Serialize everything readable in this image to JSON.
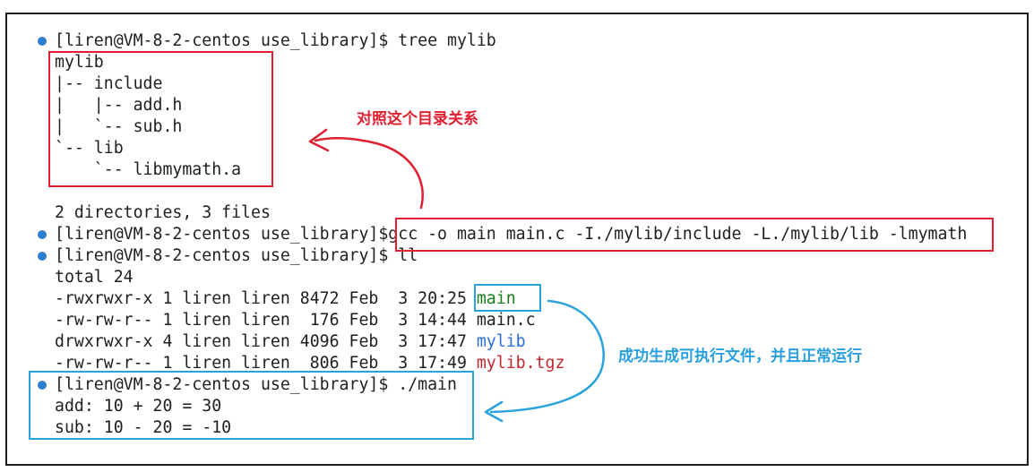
{
  "terminal": {
    "prompt1": "[liren@VM-8-2-centos use_library]$ tree mylib",
    "tree": {
      "root": "mylib",
      "l1": "|-- include",
      "l2": "|   |-- add.h",
      "l3": "|   `-- sub.h",
      "l4": "`-- lib",
      "l5": "    `-- libmymath.a"
    },
    "summary": "2 directories, 3 files",
    "prompt2_prefix": "[liren@VM-8-2-centos use_library]$",
    "prompt2_cmd": "gcc -o main main.c -I./mylib/include -L./mylib/lib -lmymath",
    "prompt3": "[liren@VM-8-2-centos use_library]$ ll",
    "total": "total 24",
    "listing": [
      {
        "meta": "-rwxrwxr-x 1 liren liren 8472 Feb  3 20:25 ",
        "name": "main"
      },
      {
        "meta": "-rw-rw-r-- 1 liren liren  176 Feb  3 14:44 ",
        "name": "main.c"
      },
      {
        "meta": "drwxrwxr-x 4 liren liren 4096 Feb  3 17:47 ",
        "name": "mylib"
      },
      {
        "meta": "-rw-rw-r-- 1 liren liren  806 Feb  3 17:49 ",
        "name": "mylib.tgz"
      }
    ],
    "prompt4": "[liren@VM-8-2-centos use_library]$ ./main",
    "out1": "add: 10 + 20 = 30",
    "out2": "sub: 10 - 20 = -10"
  },
  "annotations": {
    "tree_note": "对照这个目录关系",
    "run_note": "成功生成可执行文件，并且正常运行"
  },
  "colors": {
    "prompt_dot": "#2f7fd1",
    "executable": "#1a7f1a",
    "directory": "#2b6fd6",
    "archive": "#c0262d",
    "red_highlight": "#e02030",
    "blue_highlight": "#2aa3dc"
  }
}
